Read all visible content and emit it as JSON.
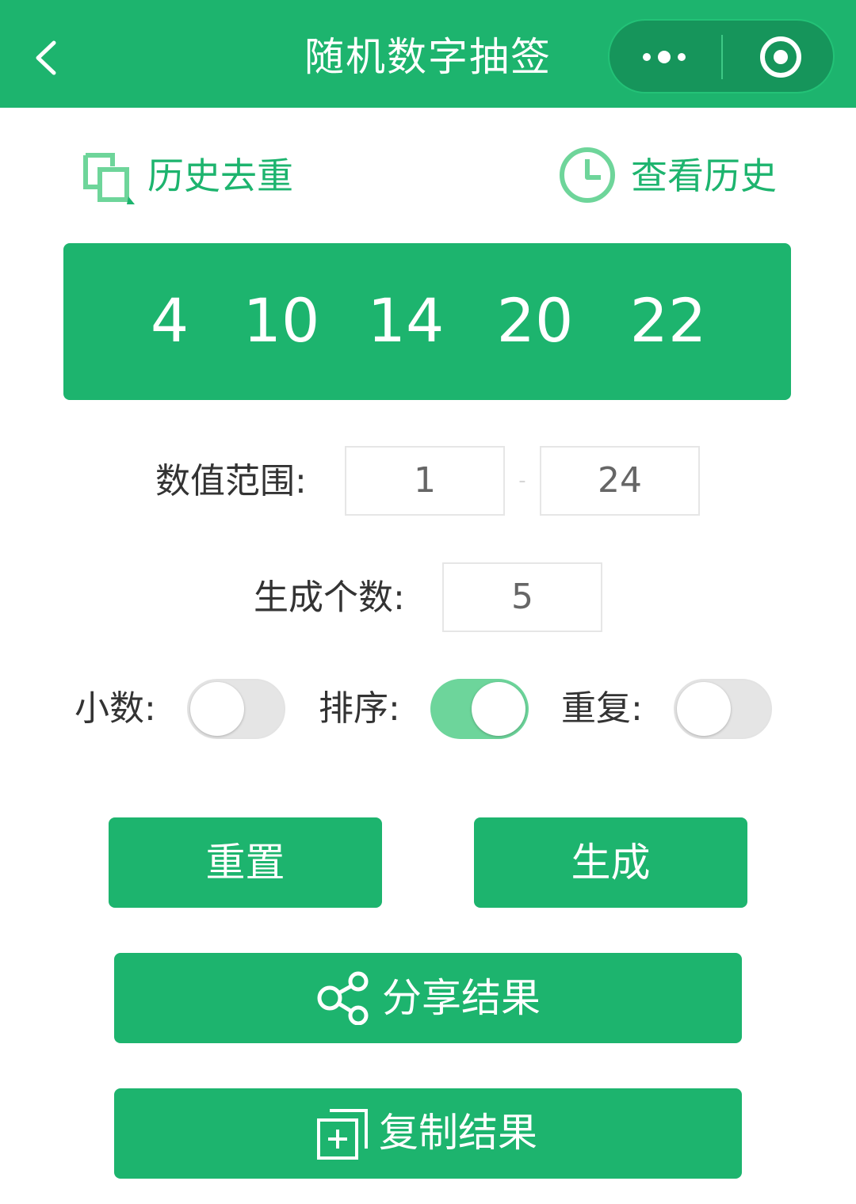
{
  "header": {
    "title": "随机数字抽签",
    "icons": {
      "back": "chevron-left-icon",
      "more": "more-dots-icon",
      "close": "target-circle-icon"
    },
    "colors": {
      "bar": "#1db46e",
      "capsule": "#16955b"
    }
  },
  "links": {
    "dedupe_label": "历史去重",
    "history_label": "查看历史"
  },
  "result": {
    "numbers": [
      "4",
      "10",
      "14",
      "20",
      "22"
    ]
  },
  "form": {
    "range_label": "数值范围:",
    "range_min": "1",
    "range_separator": "-",
    "range_max": "24",
    "count_label": "生成个数:",
    "count_value": "5",
    "decimal_label": "小数:",
    "decimal_on": false,
    "sort_label": "排序:",
    "sort_on": true,
    "repeat_label": "重复:",
    "repeat_on": false
  },
  "buttons": {
    "reset": "重置",
    "generate": "生成",
    "share": "分享结果",
    "copy": "复制结果"
  },
  "colors": {
    "accent": "#1db46e",
    "switch_on": "#6dd59b",
    "switch_off": "#e5e5e5"
  }
}
